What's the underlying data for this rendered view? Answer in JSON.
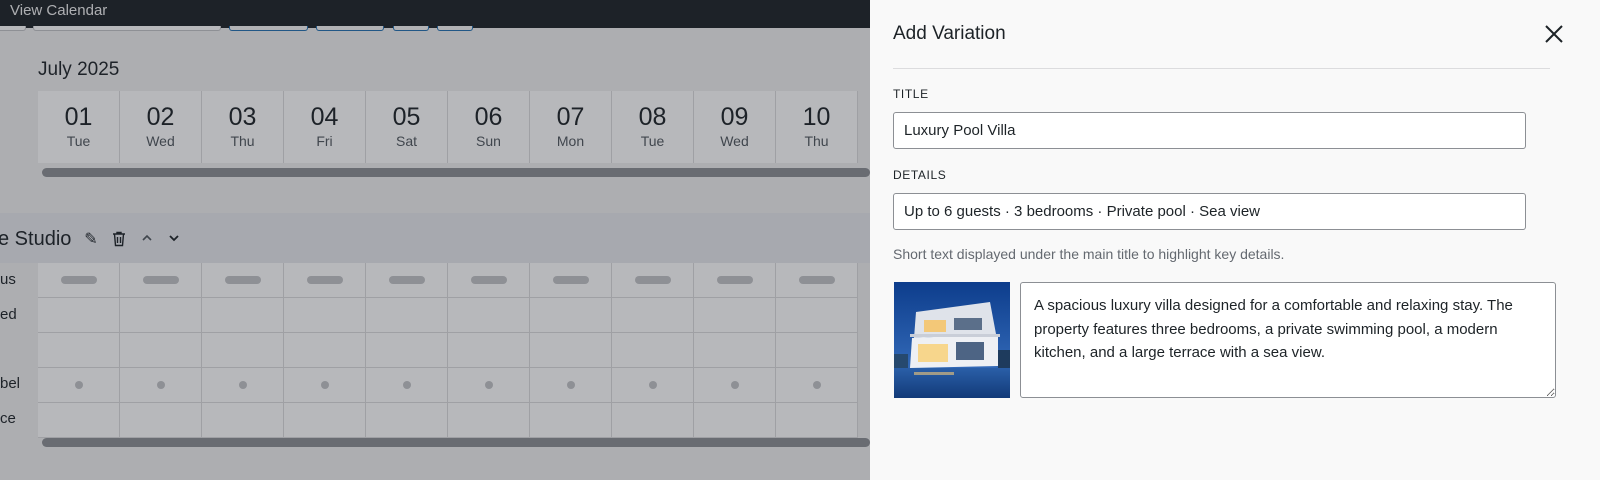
{
  "adminbar": {
    "label": "View Calendar"
  },
  "calendar": {
    "month": "July 2025",
    "days": [
      {
        "num": "01",
        "dow": "Tue"
      },
      {
        "num": "02",
        "dow": "Wed"
      },
      {
        "num": "03",
        "dow": "Thu"
      },
      {
        "num": "04",
        "dow": "Fri"
      },
      {
        "num": "05",
        "dow": "Sat"
      },
      {
        "num": "06",
        "dow": "Sun"
      },
      {
        "num": "07",
        "dow": "Mon"
      },
      {
        "num": "08",
        "dow": "Tue"
      },
      {
        "num": "09",
        "dow": "Wed"
      },
      {
        "num": "10",
        "dow": "Thu"
      }
    ]
  },
  "unit": {
    "title": "e Studio",
    "row_labels": [
      "us",
      "ed",
      "",
      "bel",
      "ce"
    ]
  },
  "panel": {
    "title": "Add Variation",
    "title_label": "TITLE",
    "title_value": "Luxury Pool Villa",
    "details_label": "DETAILS",
    "details_value": "Up to 6 guests · 3 bedrooms · Private pool · Sea view",
    "details_help": "Short text displayed under the main title to highlight key details.",
    "description": "A spacious luxury villa designed for a comfortable and relaxing stay. The property features three bedrooms, a private swimming pool, a modern kitchen, and a large terrace with a sea view."
  },
  "colors": {
    "adminbar": "#1d2327",
    "overlay": "rgba(30,35,45,0.32)",
    "panel_bg": "#f9f9f9",
    "accent": "#2271b1"
  },
  "icons": {
    "close": "close-icon",
    "edit": "pencil-icon",
    "delete": "trash-icon",
    "up": "chevron-up-icon",
    "down": "chevron-down-icon"
  }
}
